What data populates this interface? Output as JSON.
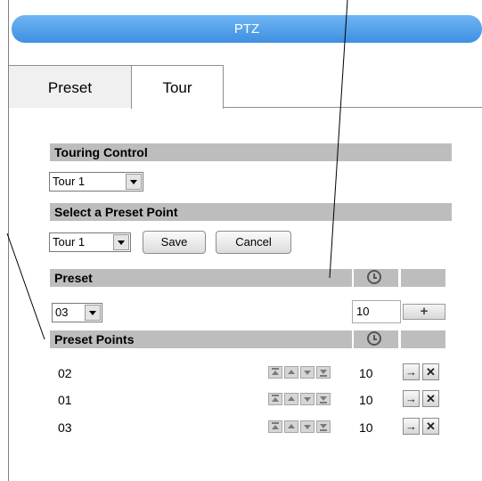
{
  "header": {
    "title": "PTZ"
  },
  "tabs": [
    {
      "label": "Preset",
      "active": false
    },
    {
      "label": "Tour",
      "active": true
    }
  ],
  "touring_control": {
    "title": "Touring Control",
    "tour_select": "Tour 1"
  },
  "select_preset_point": {
    "title": "Select a Preset Point",
    "tour_select": "Tour 1",
    "save_label": "Save",
    "cancel_label": "Cancel"
  },
  "preset": {
    "title": "Preset",
    "clock_icon": "clock-icon",
    "preset_select": "03",
    "dwell_value": "10",
    "add_icon": "plus-icon"
  },
  "preset_points": {
    "title": "Preset Points",
    "clock_icon": "clock-icon",
    "rows": [
      {
        "name": "02",
        "time": "10"
      },
      {
        "name": "01",
        "time": "10"
      },
      {
        "name": "03",
        "time": "10"
      }
    ]
  },
  "colors": {
    "accent": "#4a9be8",
    "header_gray": "#bdbdbd"
  }
}
